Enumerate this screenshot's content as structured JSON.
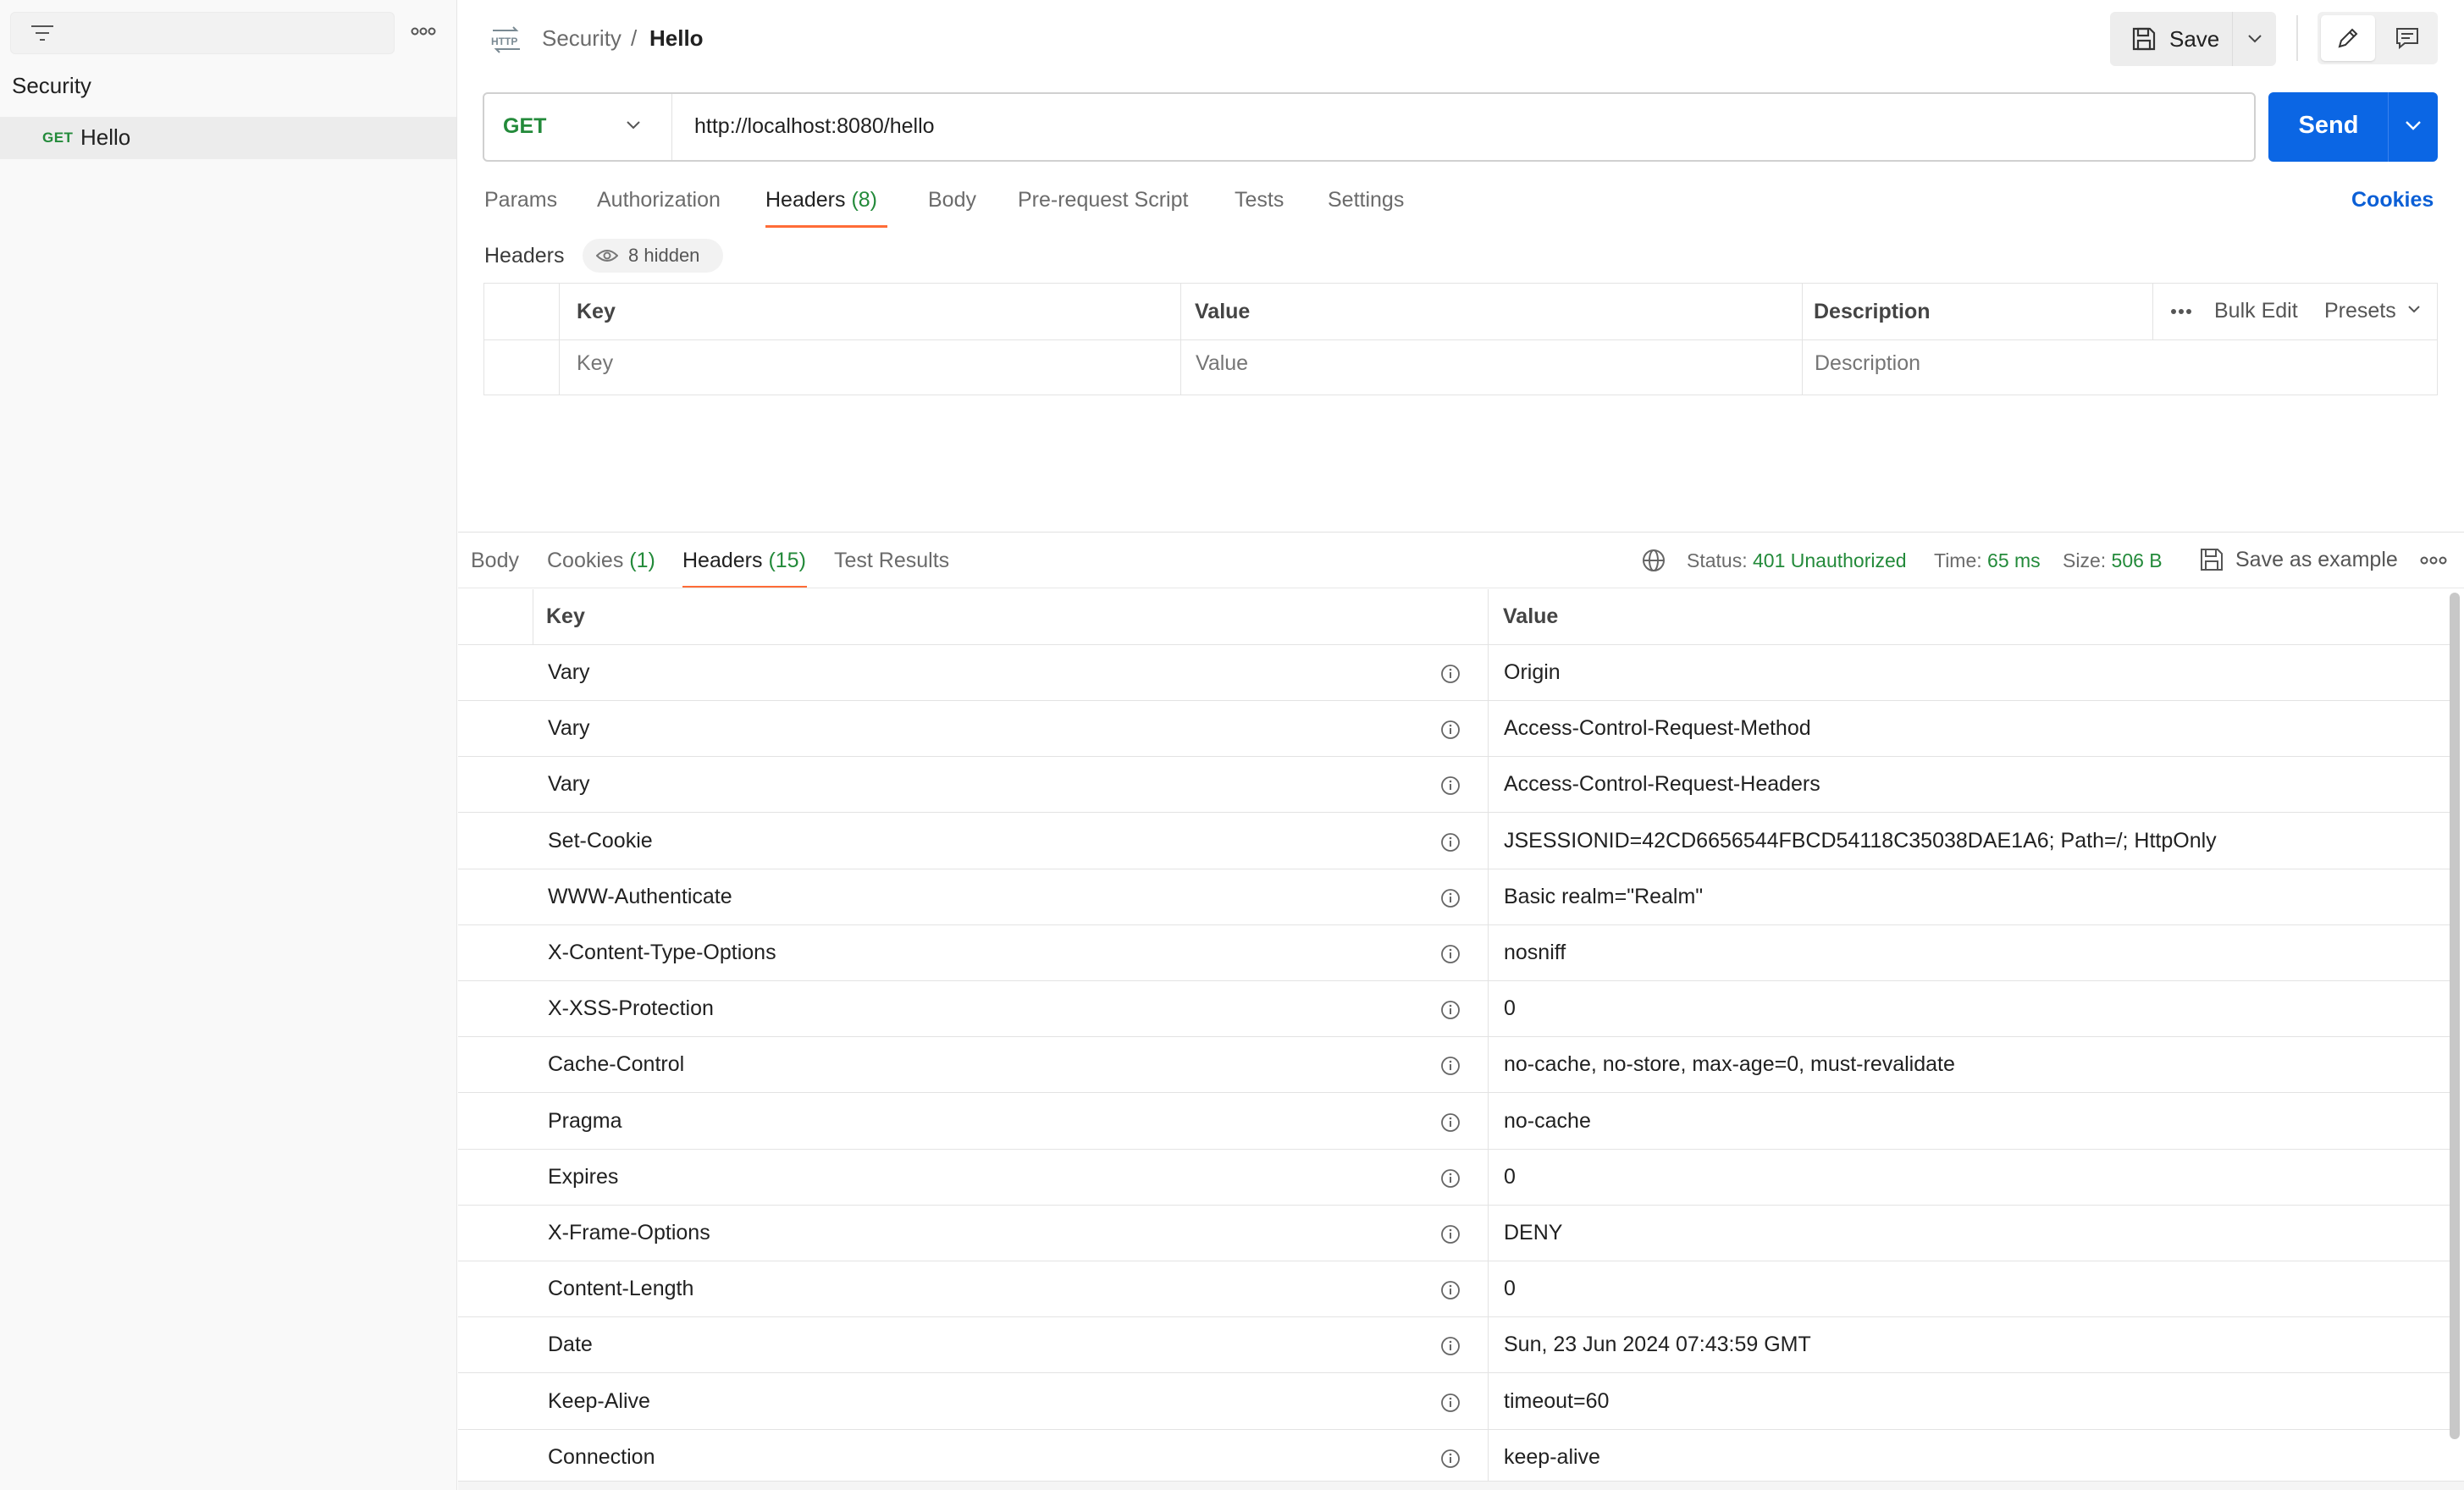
{
  "sidebar": {
    "collection": "Security",
    "request": {
      "method": "GET",
      "name": "Hello"
    }
  },
  "header": {
    "breadcrumb_collection": "Security",
    "breadcrumb_separator": "/",
    "breadcrumb_request": "Hello",
    "save_label": "Save"
  },
  "request": {
    "method": "GET",
    "url": "http://localhost:8080/hello",
    "send_label": "Send",
    "tabs": [
      {
        "label": "Params",
        "count": ""
      },
      {
        "label": "Authorization",
        "count": ""
      },
      {
        "label": "Headers",
        "count": "(8)"
      },
      {
        "label": "Body",
        "count": ""
      },
      {
        "label": "Pre-request Script",
        "count": ""
      },
      {
        "label": "Tests",
        "count": ""
      },
      {
        "label": "Settings",
        "count": ""
      }
    ],
    "cookies_label": "Cookies",
    "headers_label": "Headers",
    "hidden_label": "8 hidden",
    "table": {
      "key_header": "Key",
      "value_header": "Value",
      "description_header": "Description",
      "key_placeholder": "Key",
      "value_placeholder": "Value",
      "description_placeholder": "Description",
      "bulk_edit": "Bulk Edit",
      "presets": "Presets"
    }
  },
  "response": {
    "tabs": [
      {
        "label": "Body",
        "count": ""
      },
      {
        "label": "Cookies",
        "count": "(1)"
      },
      {
        "label": "Headers",
        "count": "(15)"
      },
      {
        "label": "Test Results",
        "count": ""
      }
    ],
    "status_label": "Status:",
    "status_value": "401 Unauthorized",
    "time_label": "Time:",
    "time_value": "65 ms",
    "size_label": "Size:",
    "size_value": "506 B",
    "save_example": "Save as example",
    "key_header": "Key",
    "value_header": "Value",
    "headers": [
      {
        "key": "Vary",
        "value": "Origin"
      },
      {
        "key": "Vary",
        "value": "Access-Control-Request-Method"
      },
      {
        "key": "Vary",
        "value": "Access-Control-Request-Headers"
      },
      {
        "key": "Set-Cookie",
        "value": "JSESSIONID=42CD6656544FBCD54118C35038DAE1A6; Path=/; HttpOnly"
      },
      {
        "key": "WWW-Authenticate",
        "value": "Basic realm=\"Realm\""
      },
      {
        "key": "X-Content-Type-Options",
        "value": "nosniff"
      },
      {
        "key": "X-XSS-Protection",
        "value": "0"
      },
      {
        "key": "Cache-Control",
        "value": "no-cache, no-store, max-age=0, must-revalidate"
      },
      {
        "key": "Pragma",
        "value": "no-cache"
      },
      {
        "key": "Expires",
        "value": "0"
      },
      {
        "key": "X-Frame-Options",
        "value": "DENY"
      },
      {
        "key": "Content-Length",
        "value": "0"
      },
      {
        "key": "Date",
        "value": "Sun, 23 Jun 2024 07:43:59 GMT"
      },
      {
        "key": "Keep-Alive",
        "value": "timeout=60"
      },
      {
        "key": "Connection",
        "value": "keep-alive"
      }
    ]
  },
  "colors": {
    "accent_blue": "#0b66e4",
    "method_green": "#238a3a",
    "tab_underline": "#ff6c37"
  }
}
